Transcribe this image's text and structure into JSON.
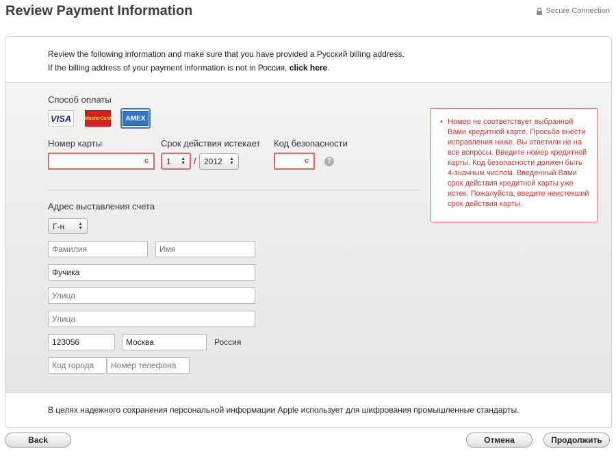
{
  "header": {
    "title": "Review Payment Information",
    "secure_label": "Secure Connection",
    "secure_icon": "lock-icon"
  },
  "intro": {
    "line1": "Review the following information and make sure that you have provided a Русский billing address.",
    "line2_prefix": "If the billing address of your payment information is not in Россия, ",
    "line2_link": "click here",
    "line2_suffix": "."
  },
  "payment": {
    "method_label": "Способ оплаты",
    "cards": {
      "visa": "VISA",
      "mastercard": "MasterCard",
      "amex": "AMEX",
      "selected": "amex"
    },
    "card_number_label": "Номер карты",
    "card_number_value": "",
    "expiry_label": "Срок действия истекает",
    "expiry_month": "1",
    "expiry_separator": "/",
    "expiry_year": "2012",
    "security_code_label": "Код безопасности",
    "security_code_value": "",
    "help_icon": "?"
  },
  "error": {
    "message": "Номер не соответствует выбранной Вами кредитной карте. Просьба внести исправления ниже. Вы ответили не на все вопросы. Введите номер кредитной карты. Код безопасности должен быть 4-значным числом. Введенный Вами срок действия кредитной карты уже истек. Пожалуйста, введите неистекший срок действия карты.",
    "color": "#d4352a"
  },
  "billing": {
    "label": "Адрес выставления счета",
    "salutation": "Г-н",
    "last_name_placeholder": "Фамилия",
    "first_name_placeholder": "Имя",
    "street1_value": "Фучика",
    "street2_placeholder": "Улица",
    "street3_placeholder": "Улица",
    "postal_code": "123056",
    "city": "Москва",
    "country": "Россия",
    "area_code_placeholder": "Код города",
    "phone_placeholder": "Номер телефона"
  },
  "footer": {
    "note": "В целях надежного сохранения персональной информации Apple использует для шифрования промышленные стандарты."
  },
  "buttons": {
    "back": "Back",
    "cancel": "Отмена",
    "continue": "Продолжить"
  }
}
